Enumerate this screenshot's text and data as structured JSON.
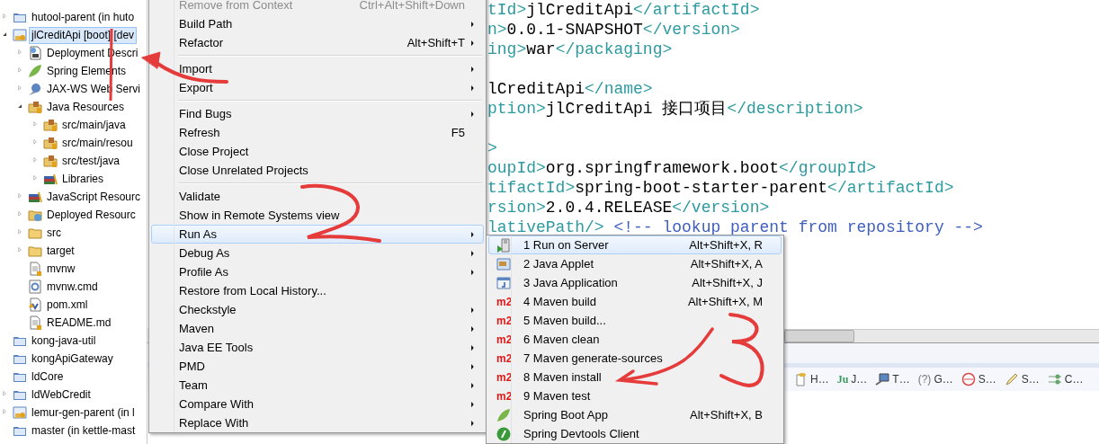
{
  "project_explorer": {
    "items": [
      {
        "label": "hutool-parent (in huto",
        "kind": "project",
        "expanded": false,
        "selected": false
      },
      {
        "label": "jlCreditApi [boot] [dev",
        "kind": "web-project",
        "expanded": true,
        "selected": true,
        "children": [
          {
            "label": "Deployment Descri",
            "kind": "descriptor",
            "expanded": false,
            "selected": false
          },
          {
            "label": "Spring Elements",
            "kind": "leaf",
            "expanded": false,
            "selected": false
          },
          {
            "label": "JAX-WS Web Servi",
            "kind": "webservice",
            "expanded": false,
            "selected": false
          },
          {
            "label": "Java Resources",
            "kind": "package-root",
            "expanded": true,
            "selected": false,
            "children": [
              {
                "label": "src/main/java",
                "kind": "package-root",
                "expanded": false,
                "selected": false
              },
              {
                "label": "src/main/resou",
                "kind": "package-root",
                "expanded": false,
                "selected": false
              },
              {
                "label": "src/test/java",
                "kind": "package-root",
                "expanded": false,
                "selected": false
              },
              {
                "label": "Libraries",
                "kind": "library",
                "expanded": false,
                "selected": false
              }
            ]
          },
          {
            "label": "JavaScript Resourc",
            "kind": "library",
            "expanded": false,
            "selected": false
          },
          {
            "label": "Deployed Resourc",
            "kind": "deployed",
            "expanded": false,
            "selected": false
          },
          {
            "label": "src",
            "kind": "folder",
            "expanded": false,
            "selected": false
          },
          {
            "label": "target",
            "kind": "folder",
            "expanded": false,
            "selected": false
          },
          {
            "label": "mvnw",
            "kind": "file",
            "selected": false
          },
          {
            "label": "mvnw.cmd",
            "kind": "gear-file",
            "selected": false
          },
          {
            "label": "pom.xml",
            "kind": "xml-file",
            "selected": false
          },
          {
            "label": "README.md",
            "kind": "file",
            "selected": false
          }
        ]
      },
      {
        "label": "kong-java-util",
        "kind": "project",
        "selected": false
      },
      {
        "label": "kongApiGateway",
        "kind": "project",
        "selected": false
      },
      {
        "label": "ldCore",
        "kind": "project",
        "selected": false
      },
      {
        "label": "ldWebCredit",
        "kind": "project",
        "expanded": false,
        "selected": false
      },
      {
        "label": "lemur-gen-parent (in l",
        "kind": "web-project",
        "expanded": false,
        "selected": false
      },
      {
        "label": "master (in kettle-mast",
        "kind": "project",
        "selected": false
      }
    ]
  },
  "editor": {
    "lines": [
      {
        "kind": "code",
        "segments": [
          {
            "kind": "tag",
            "text": "tId>"
          },
          {
            "kind": "text",
            "text": "jlCreditApi"
          },
          {
            "kind": "tag",
            "text": "</artifactId>"
          }
        ]
      },
      {
        "kind": "code",
        "segments": [
          {
            "kind": "tag",
            "text": "n>"
          },
          {
            "kind": "text",
            "text": "0.0.1-SNAPSHOT"
          },
          {
            "kind": "tag",
            "text": "</version>"
          }
        ]
      },
      {
        "kind": "code",
        "segments": [
          {
            "kind": "tag",
            "text": "ing>"
          },
          {
            "kind": "text",
            "text": "war"
          },
          {
            "kind": "tag",
            "text": "</packaging>"
          }
        ]
      },
      {
        "kind": "blank"
      },
      {
        "kind": "code",
        "segments": [
          {
            "kind": "text",
            "text": "lCreditApi"
          },
          {
            "kind": "tag",
            "text": "</name>"
          }
        ]
      },
      {
        "kind": "code",
        "segments": [
          {
            "kind": "tag",
            "text": "ption>"
          },
          {
            "kind": "text",
            "text": "jlCreditApi 接口项目"
          },
          {
            "kind": "tag",
            "text": "</description>"
          }
        ]
      },
      {
        "kind": "blank"
      },
      {
        "kind": "code",
        "segments": [
          {
            "kind": "tag",
            "text": ">"
          }
        ]
      },
      {
        "kind": "code",
        "segments": [
          {
            "kind": "tag",
            "text": "oupId>"
          },
          {
            "kind": "text",
            "text": "org.springframework.boot"
          },
          {
            "kind": "tag",
            "text": "</groupId>"
          }
        ]
      },
      {
        "kind": "code",
        "segments": [
          {
            "kind": "tag",
            "text": "tifactId>"
          },
          {
            "kind": "text",
            "text": "spring-boot-starter-parent"
          },
          {
            "kind": "tag",
            "text": "</artifactId>"
          }
        ]
      },
      {
        "kind": "code",
        "segments": [
          {
            "kind": "tag",
            "text": "rsion>"
          },
          {
            "kind": "text",
            "text": "2.0.4.RELEASE"
          },
          {
            "kind": "tag",
            "text": "</version>"
          }
        ]
      },
      {
        "kind": "code",
        "segments": [
          {
            "kind": "tag",
            "text": "lativePath/>"
          },
          {
            "kind": "comment",
            "text": " <!-- lookup parent from repository -->"
          }
        ]
      }
    ]
  },
  "view_tabs": [
    {
      "kind": "file-db",
      "label": "H…"
    },
    {
      "kind": "junit",
      "glyph": "Ju",
      "label": "J…"
    },
    {
      "kind": "terminal",
      "label": "T…"
    },
    {
      "kind": "help",
      "glyph": "(?)",
      "label": "G…"
    },
    {
      "kind": "no-entry",
      "label": "S…"
    },
    {
      "kind": "pen",
      "label": "S…"
    },
    {
      "kind": "nodes",
      "label": "C…"
    }
  ],
  "context_menu": {
    "items": [
      {
        "kind": "item",
        "label": "Remove from Context",
        "shortcut": "Ctrl+Alt+Shift+Down",
        "submenu": false,
        "disabled": true,
        "selected": false
      },
      {
        "kind": "item",
        "label": "Build Path",
        "submenu": true,
        "disabled": false,
        "selected": false
      },
      {
        "kind": "item",
        "label": "Refactor",
        "shortcut": "Alt+Shift+T",
        "submenu": true,
        "disabled": false,
        "selected": false
      },
      {
        "kind": "separator"
      },
      {
        "kind": "item",
        "label": "Import",
        "submenu": true,
        "disabled": false,
        "selected": false
      },
      {
        "kind": "item",
        "label": "Export",
        "submenu": true,
        "disabled": false,
        "selected": false
      },
      {
        "kind": "separator"
      },
      {
        "kind": "item",
        "label": "Find Bugs",
        "submenu": true,
        "disabled": false,
        "selected": false
      },
      {
        "kind": "item",
        "label": "Refresh",
        "shortcut": "F5",
        "submenu": false,
        "disabled": false,
        "selected": false
      },
      {
        "kind": "item",
        "label": "Close Project",
        "submenu": false,
        "disabled": false,
        "selected": false
      },
      {
        "kind": "item",
        "label": "Close Unrelated Projects",
        "submenu": false,
        "disabled": false,
        "selected": false
      },
      {
        "kind": "separator"
      },
      {
        "kind": "item",
        "label": "Validate",
        "submenu": false,
        "disabled": false,
        "selected": false
      },
      {
        "kind": "item",
        "label": "Show in Remote Systems view",
        "submenu": false,
        "disabled": false,
        "selected": false
      },
      {
        "kind": "item",
        "label": "Run As",
        "submenu": true,
        "disabled": false,
        "selected": true
      },
      {
        "kind": "item",
        "label": "Debug As",
        "submenu": true,
        "disabled": false,
        "selected": false
      },
      {
        "kind": "item",
        "label": "Profile As",
        "submenu": true,
        "disabled": false,
        "selected": false
      },
      {
        "kind": "item",
        "label": "Restore from Local History...",
        "submenu": false,
        "disabled": false,
        "selected": false
      },
      {
        "kind": "item",
        "label": "Checkstyle",
        "submenu": true,
        "disabled": false,
        "selected": false
      },
      {
        "kind": "item",
        "label": "Maven",
        "submenu": true,
        "disabled": false,
        "selected": false
      },
      {
        "kind": "item",
        "label": "Java EE Tools",
        "submenu": true,
        "disabled": false,
        "selected": false
      },
      {
        "kind": "item",
        "label": "PMD",
        "submenu": true,
        "disabled": false,
        "selected": false
      },
      {
        "kind": "item",
        "label": "Team",
        "submenu": true,
        "disabled": false,
        "selected": false
      },
      {
        "kind": "item",
        "label": "Compare With",
        "submenu": true,
        "disabled": false,
        "selected": false
      },
      {
        "kind": "item",
        "label": "Replace With",
        "submenu": true,
        "disabled": false,
        "selected": false
      }
    ]
  },
  "run_as_submenu": {
    "items": [
      {
        "kind": "server",
        "label": "1 Run on Server",
        "shortcut": "Alt+Shift+X, R",
        "selected": true
      },
      {
        "kind": "applet",
        "label": "2 Java Applet",
        "shortcut": "Alt+Shift+X, A",
        "selected": false
      },
      {
        "kind": "application",
        "label": "3 Java Application",
        "shortcut": "Alt+Shift+X, J",
        "selected": false
      },
      {
        "kind": "maven",
        "glyph": "m2",
        "label": "4 Maven build",
        "shortcut": "Alt+Shift+X, M",
        "selected": false
      },
      {
        "kind": "maven",
        "glyph": "m2",
        "label": "5 Maven build...",
        "selected": false
      },
      {
        "kind": "maven",
        "glyph": "m2",
        "label": "6 Maven clean",
        "selected": false
      },
      {
        "kind": "maven",
        "glyph": "m2",
        "label": "7 Maven generate-sources",
        "selected": false
      },
      {
        "kind": "maven",
        "glyph": "m2",
        "label": "8 Maven install",
        "selected": false
      },
      {
        "kind": "maven",
        "glyph": "m2",
        "label": "9 Maven test",
        "selected": false
      },
      {
        "kind": "leaf",
        "label": "Spring Boot App",
        "shortcut": "Alt+Shift+X, B",
        "selected": false
      },
      {
        "kind": "power",
        "label": "Spring Devtools Client",
        "selected": false
      }
    ]
  }
}
